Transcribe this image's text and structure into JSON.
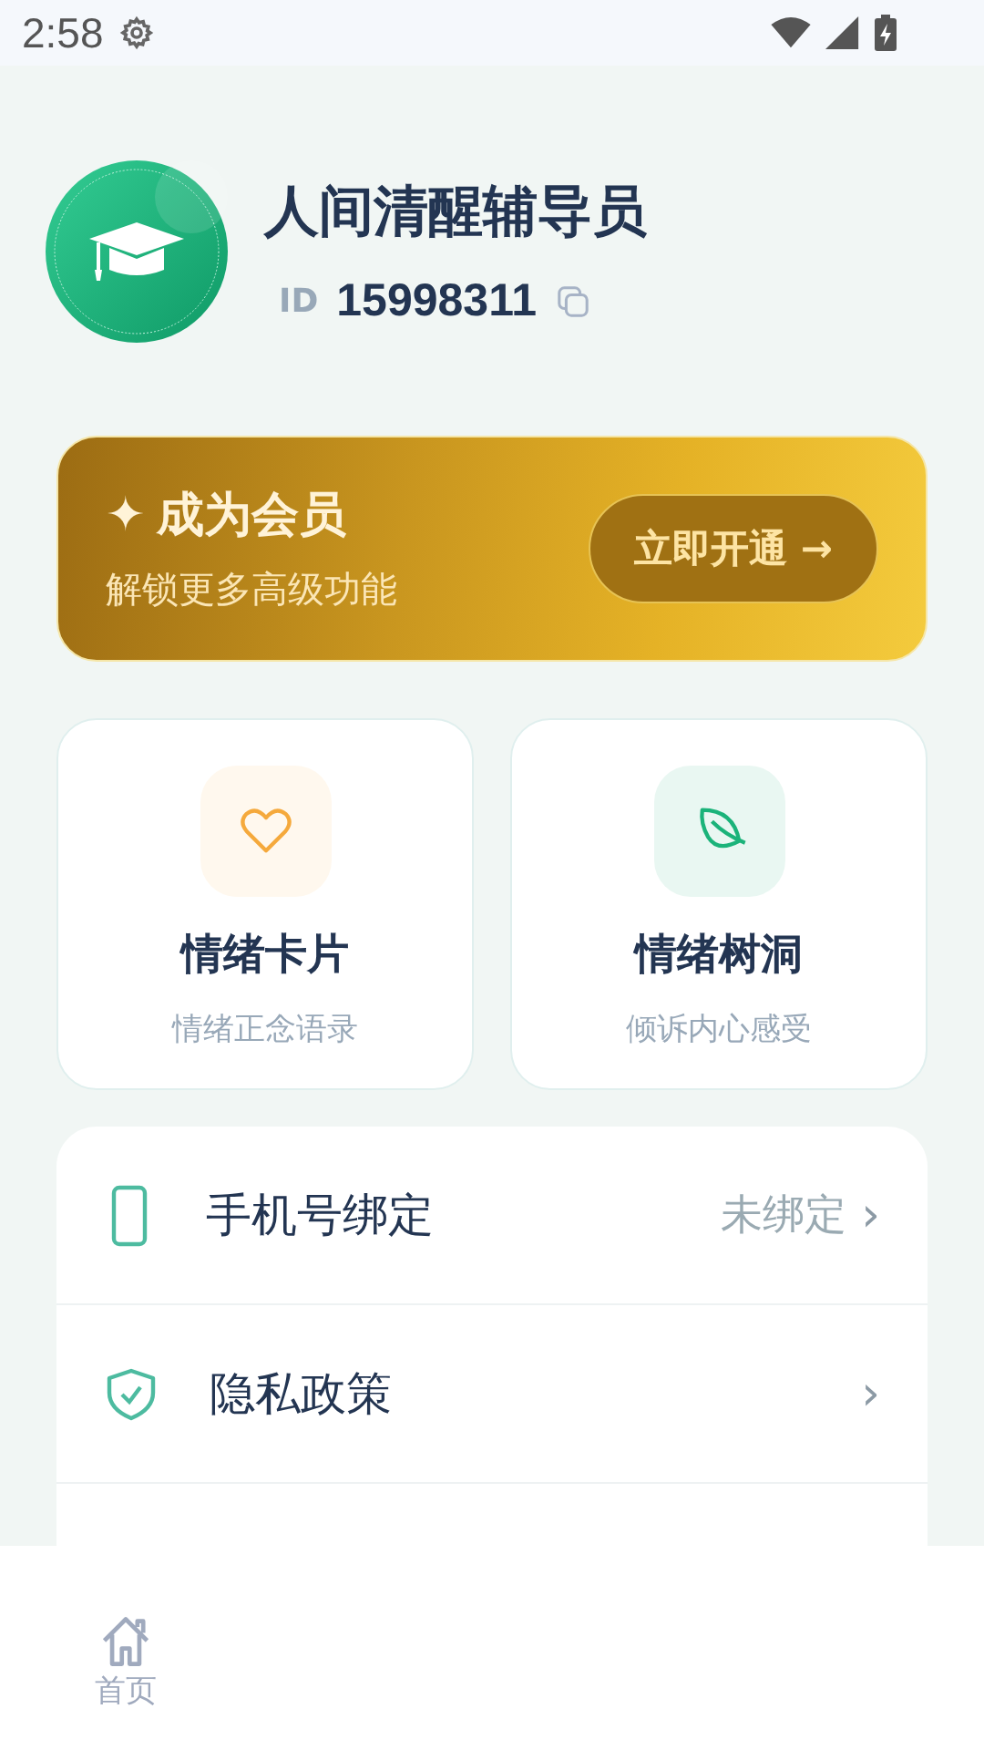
{
  "status_bar": {
    "time": "2:58"
  },
  "profile": {
    "name": "人间清醒辅导员",
    "id_label": "ID",
    "id": "15998311"
  },
  "membership": {
    "star": "✦",
    "title": "成为会员",
    "subtitle": "解锁更多高级功能",
    "button": "立即开通 →"
  },
  "features": [
    {
      "title": "情绪卡片",
      "subtitle": "情绪正念语录"
    },
    {
      "title": "情绪树洞",
      "subtitle": "倾诉内心感受"
    }
  ],
  "settings": [
    {
      "label": "手机号绑定",
      "value": "未绑定",
      "chevron": "›"
    },
    {
      "label": "隐私政策",
      "chevron": "›"
    }
  ],
  "bottom_nav": [
    {
      "label": "首页"
    }
  ]
}
